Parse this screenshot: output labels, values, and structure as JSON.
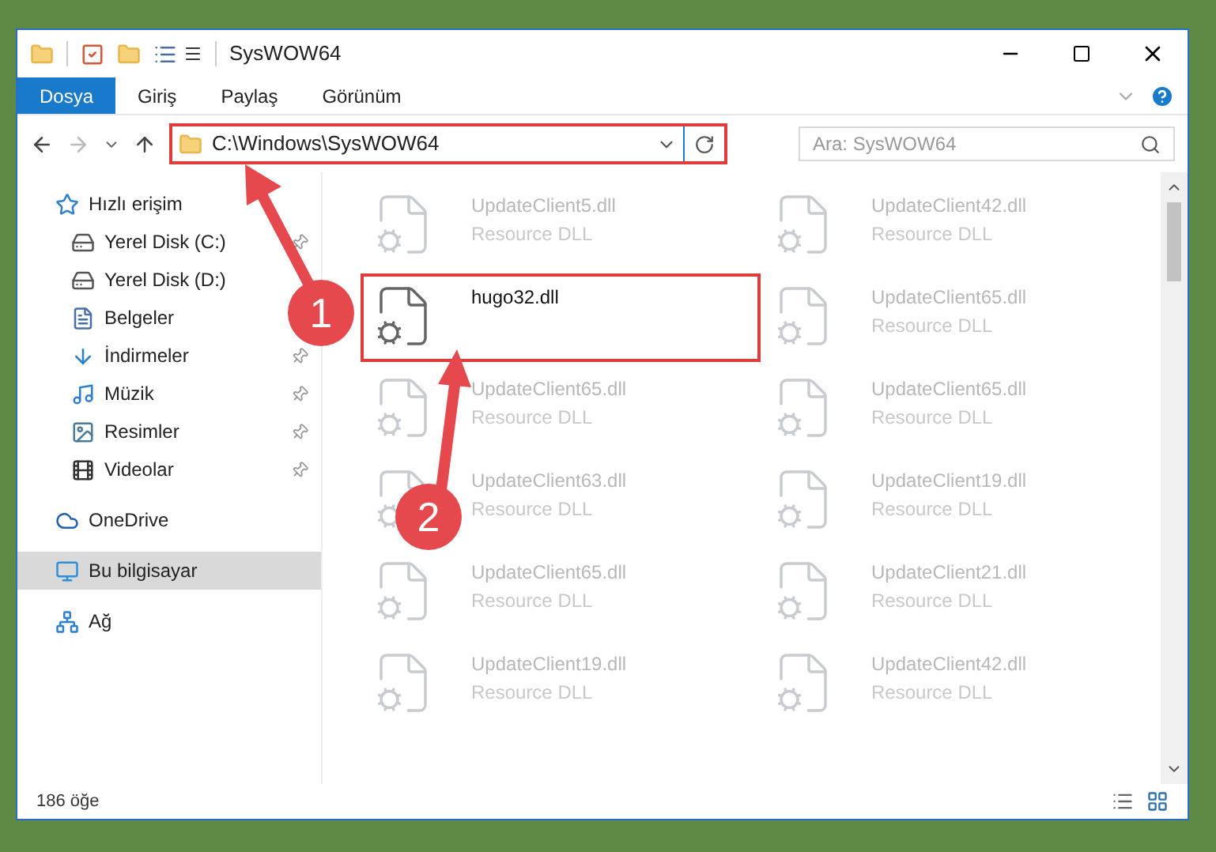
{
  "window": {
    "title": "SysWOW64"
  },
  "ribbon_tabs": [
    {
      "label": "Dosya",
      "selected": true
    },
    {
      "label": "Giriş",
      "selected": false
    },
    {
      "label": "Paylaş",
      "selected": false
    },
    {
      "label": "Görünüm",
      "selected": false
    }
  ],
  "address_bar": {
    "path": "C:\\Windows\\SysWOW64",
    "highlighted": true
  },
  "search": {
    "placeholder": "Ara: SysWOW64"
  },
  "sidebar": {
    "items": [
      {
        "label": "Hızlı erişim",
        "kind": "star",
        "pinned": false,
        "selected": false,
        "children": [
          {
            "label": "Yerel Disk (C:)",
            "kind": "disk",
            "pinned": true,
            "selected": false
          },
          {
            "label": "Yerel Disk (D:)",
            "kind": "disk",
            "pinned": false,
            "selected": false
          },
          {
            "label": "Belgeler",
            "kind": "document",
            "pinned": false,
            "selected": false
          },
          {
            "label": "İndirmeler",
            "kind": "download",
            "pinned": true,
            "selected": false
          },
          {
            "label": "Müzik",
            "kind": "music",
            "pinned": true,
            "selected": false
          },
          {
            "label": "Resimler",
            "kind": "picture",
            "pinned": true,
            "selected": false
          },
          {
            "label": "Videolar",
            "kind": "video",
            "pinned": true,
            "selected": false
          }
        ]
      },
      {
        "label": "OneDrive",
        "kind": "cloud",
        "pinned": false,
        "selected": false
      },
      {
        "label": "Bu bilgisayar",
        "kind": "computer",
        "pinned": false,
        "selected": true
      },
      {
        "label": "Ağ",
        "kind": "network",
        "pinned": false,
        "selected": false
      }
    ]
  },
  "files": [
    {
      "name": "UpdateClient5.dll",
      "type": "Resource DLL",
      "highlighted": false
    },
    {
      "name": "UpdateClient42.dll",
      "type": "Resource DLL",
      "highlighted": false
    },
    {
      "name": "hugo32.dll",
      "highlighted": true
    },
    {
      "name": "UpdateClient65.dll",
      "type": "Resource DLL",
      "highlighted": false
    },
    {
      "name": "UpdateClient65.dll",
      "type": "Resource DLL",
      "highlighted": false
    },
    {
      "name": "UpdateClient65.dll",
      "type": "Resource DLL",
      "highlighted": false
    },
    {
      "name": "UpdateClient63.dll",
      "type": "Resource DLL",
      "highlighted": false
    },
    {
      "name": "UpdateClient19.dll",
      "type": "Resource DLL",
      "highlighted": false
    },
    {
      "name": "UpdateClient65.dll",
      "type": "Resource DLL",
      "highlighted": false
    },
    {
      "name": "UpdateClient21.dll",
      "type": "Resource DLL",
      "highlighted": false
    },
    {
      "name": "UpdateClient19.dll",
      "type": "Resource DLL",
      "highlighted": false
    },
    {
      "name": "UpdateClient42.dll",
      "type": "Resource DLL",
      "highlighted": false
    }
  ],
  "status_bar": {
    "count": "186 öğe"
  },
  "annotations": [
    {
      "number": "1"
    },
    {
      "number": "2"
    }
  ]
}
